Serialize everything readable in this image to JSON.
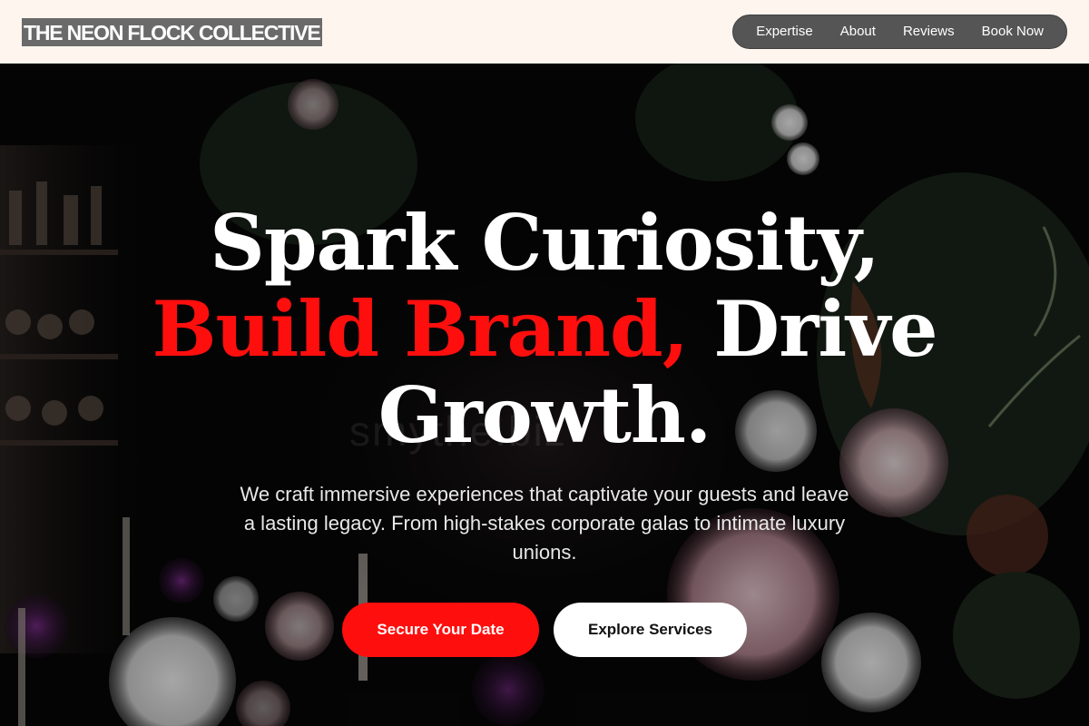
{
  "header": {
    "logo": "THE NEON FLOCK COLLECTIVE",
    "nav": [
      {
        "label": "Expertise"
      },
      {
        "label": "About"
      },
      {
        "label": "Reviews"
      },
      {
        "label": "Book Now"
      }
    ]
  },
  "hero": {
    "headline_line1": "Spark Curiosity,",
    "headline_red": "Build Brand,",
    "headline_line2_rest": " Drive",
    "headline_line3": "Growth.",
    "subtitle": "We craft immersive experiences that captivate your guests and leave a lasting legacy. From high-stakes corporate galas to intimate luxury unions.",
    "primary_cta": "Secure Your Date",
    "secondary_cta": "Explore Services",
    "watermark": "smythe.biz"
  },
  "colors": {
    "accent": "#ff0e0e",
    "header_bg": "#fdf5ee",
    "nav_bg": "#555555"
  }
}
